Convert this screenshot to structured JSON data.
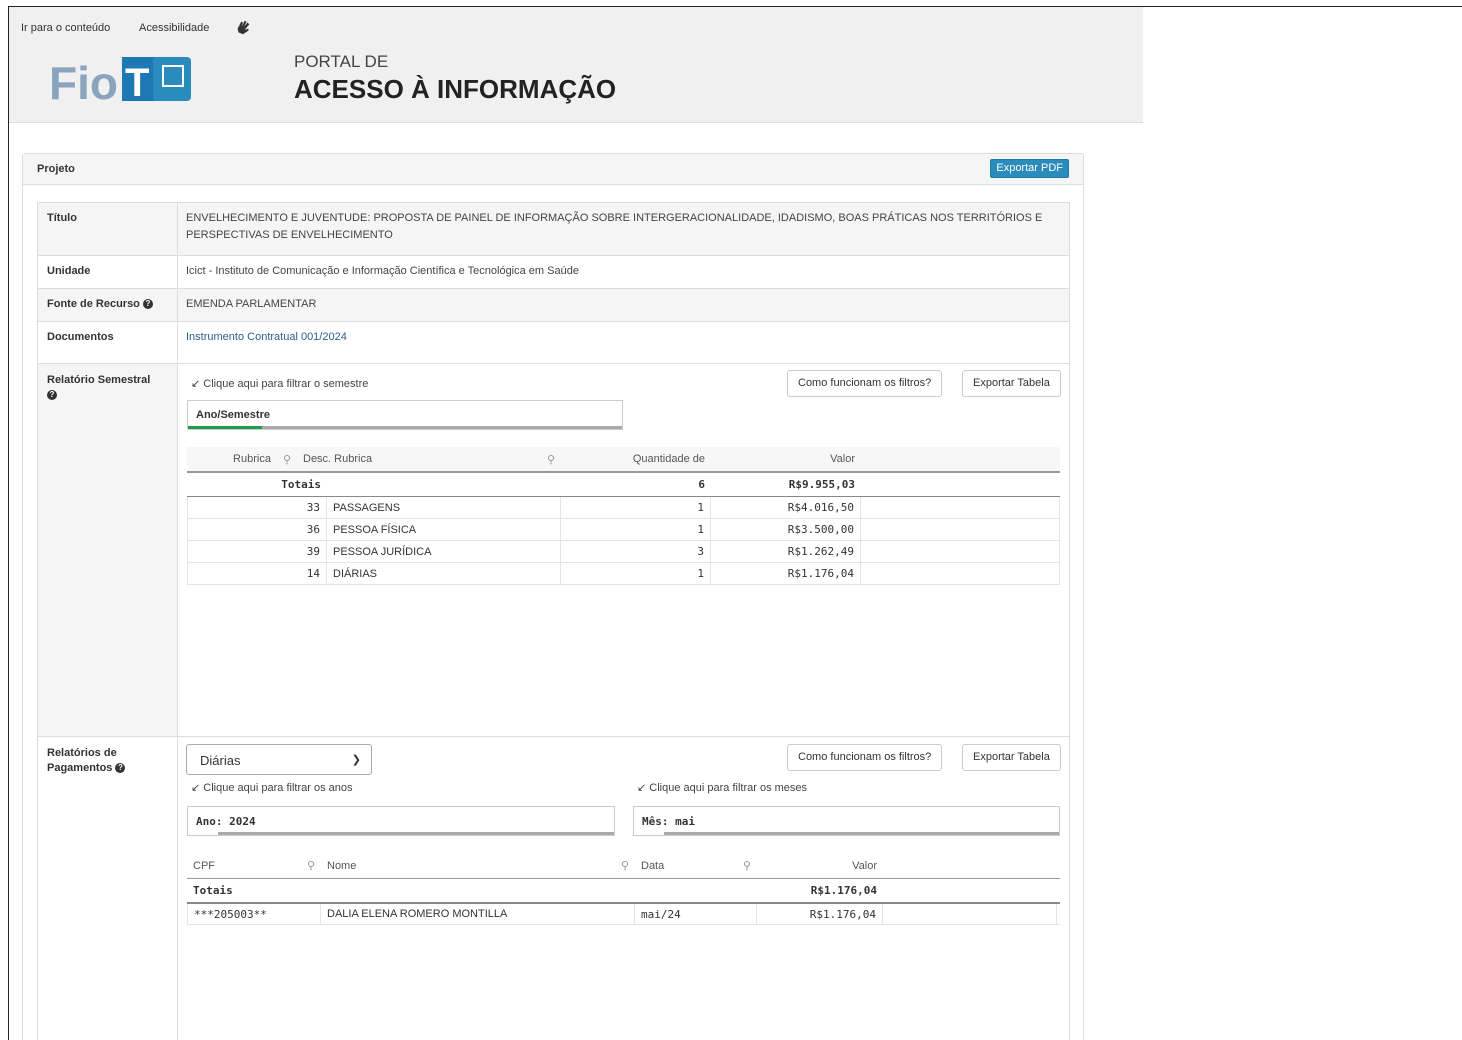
{
  "header": {
    "skip_link": "Ir para o conteúdo",
    "accessibility_link": "Acessibilidade",
    "logo_text": "FioTeC",
    "portal_small": "PORTAL DE",
    "portal_big": "ACESSO À INFORMAÇÃO"
  },
  "panel": {
    "title": "Projeto",
    "export_pdf": "Exportar PDF"
  },
  "info": {
    "titulo_label": "Título",
    "titulo_value": "ENVELHECIMENTO E JUVENTUDE: PROPOSTA DE PAINEL DE INFORMAÇÃO SOBRE INTERGERACIONALIDADE, IDADISMO, BOAS PRÁTICAS NOS TERRITÓRIOS E PERSPECTIVAS DE ENVELHECIMENTO",
    "unidade_label": "Unidade",
    "unidade_value": "Icict - Instituto de Comunicação e Informação Científica e Tecnológica em Saúde",
    "fonte_label": "Fonte de Recurso",
    "fonte_value": "EMENDA PARLAMENTAR",
    "documentos_label": "Documentos",
    "documentos_value": "Instrumento Contratual 001/2024"
  },
  "semestral": {
    "label": "Relatório Semestral",
    "hint": "Clique aqui para filtrar o semestre",
    "filter": "Ano/Semestre",
    "btn_filters": "Como funcionam os filtros?",
    "btn_export": "Exportar Tabela",
    "columns": [
      "Rubrica",
      "Desc. Rubrica",
      "Quantidade de",
      "Valor"
    ],
    "totals_label": "Totais",
    "totals_qty": "6",
    "totals_value": "R$9.955,03",
    "rows": [
      {
        "rubrica": "33",
        "desc": "PASSAGENS",
        "qty": "1",
        "valor": "R$4.016,50"
      },
      {
        "rubrica": "36",
        "desc": "PESSOA FÍSICA",
        "qty": "1",
        "valor": "R$3.500,00"
      },
      {
        "rubrica": "39",
        "desc": "PESSOA JURÍDICA",
        "qty": "3",
        "valor": "R$1.262,49"
      },
      {
        "rubrica": "14",
        "desc": "DIÁRIAS",
        "qty": "1",
        "valor": "R$1.176,04"
      }
    ]
  },
  "pagamentos": {
    "label": "Relatórios de Pagamentos",
    "select_value": "Diárias",
    "hint_anos": "Clique aqui para filtrar os anos",
    "hint_meses": "Clique aqui para filtrar os meses",
    "filter_ano": "Ano: 2024",
    "filter_mes": "Mês: mai",
    "btn_filters": "Como funcionam os filtros?",
    "btn_export": "Exportar Tabela",
    "columns": [
      "CPF",
      "Nome",
      "Data",
      "Valor"
    ],
    "totals_label": "Totais",
    "totals_value": "R$1.176,04",
    "rows": [
      {
        "cpf": "***205003**",
        "nome": "DALIA ELENA ROMERO MONTILLA",
        "data": "mai/24",
        "valor": "R$1.176,04"
      }
    ]
  }
}
